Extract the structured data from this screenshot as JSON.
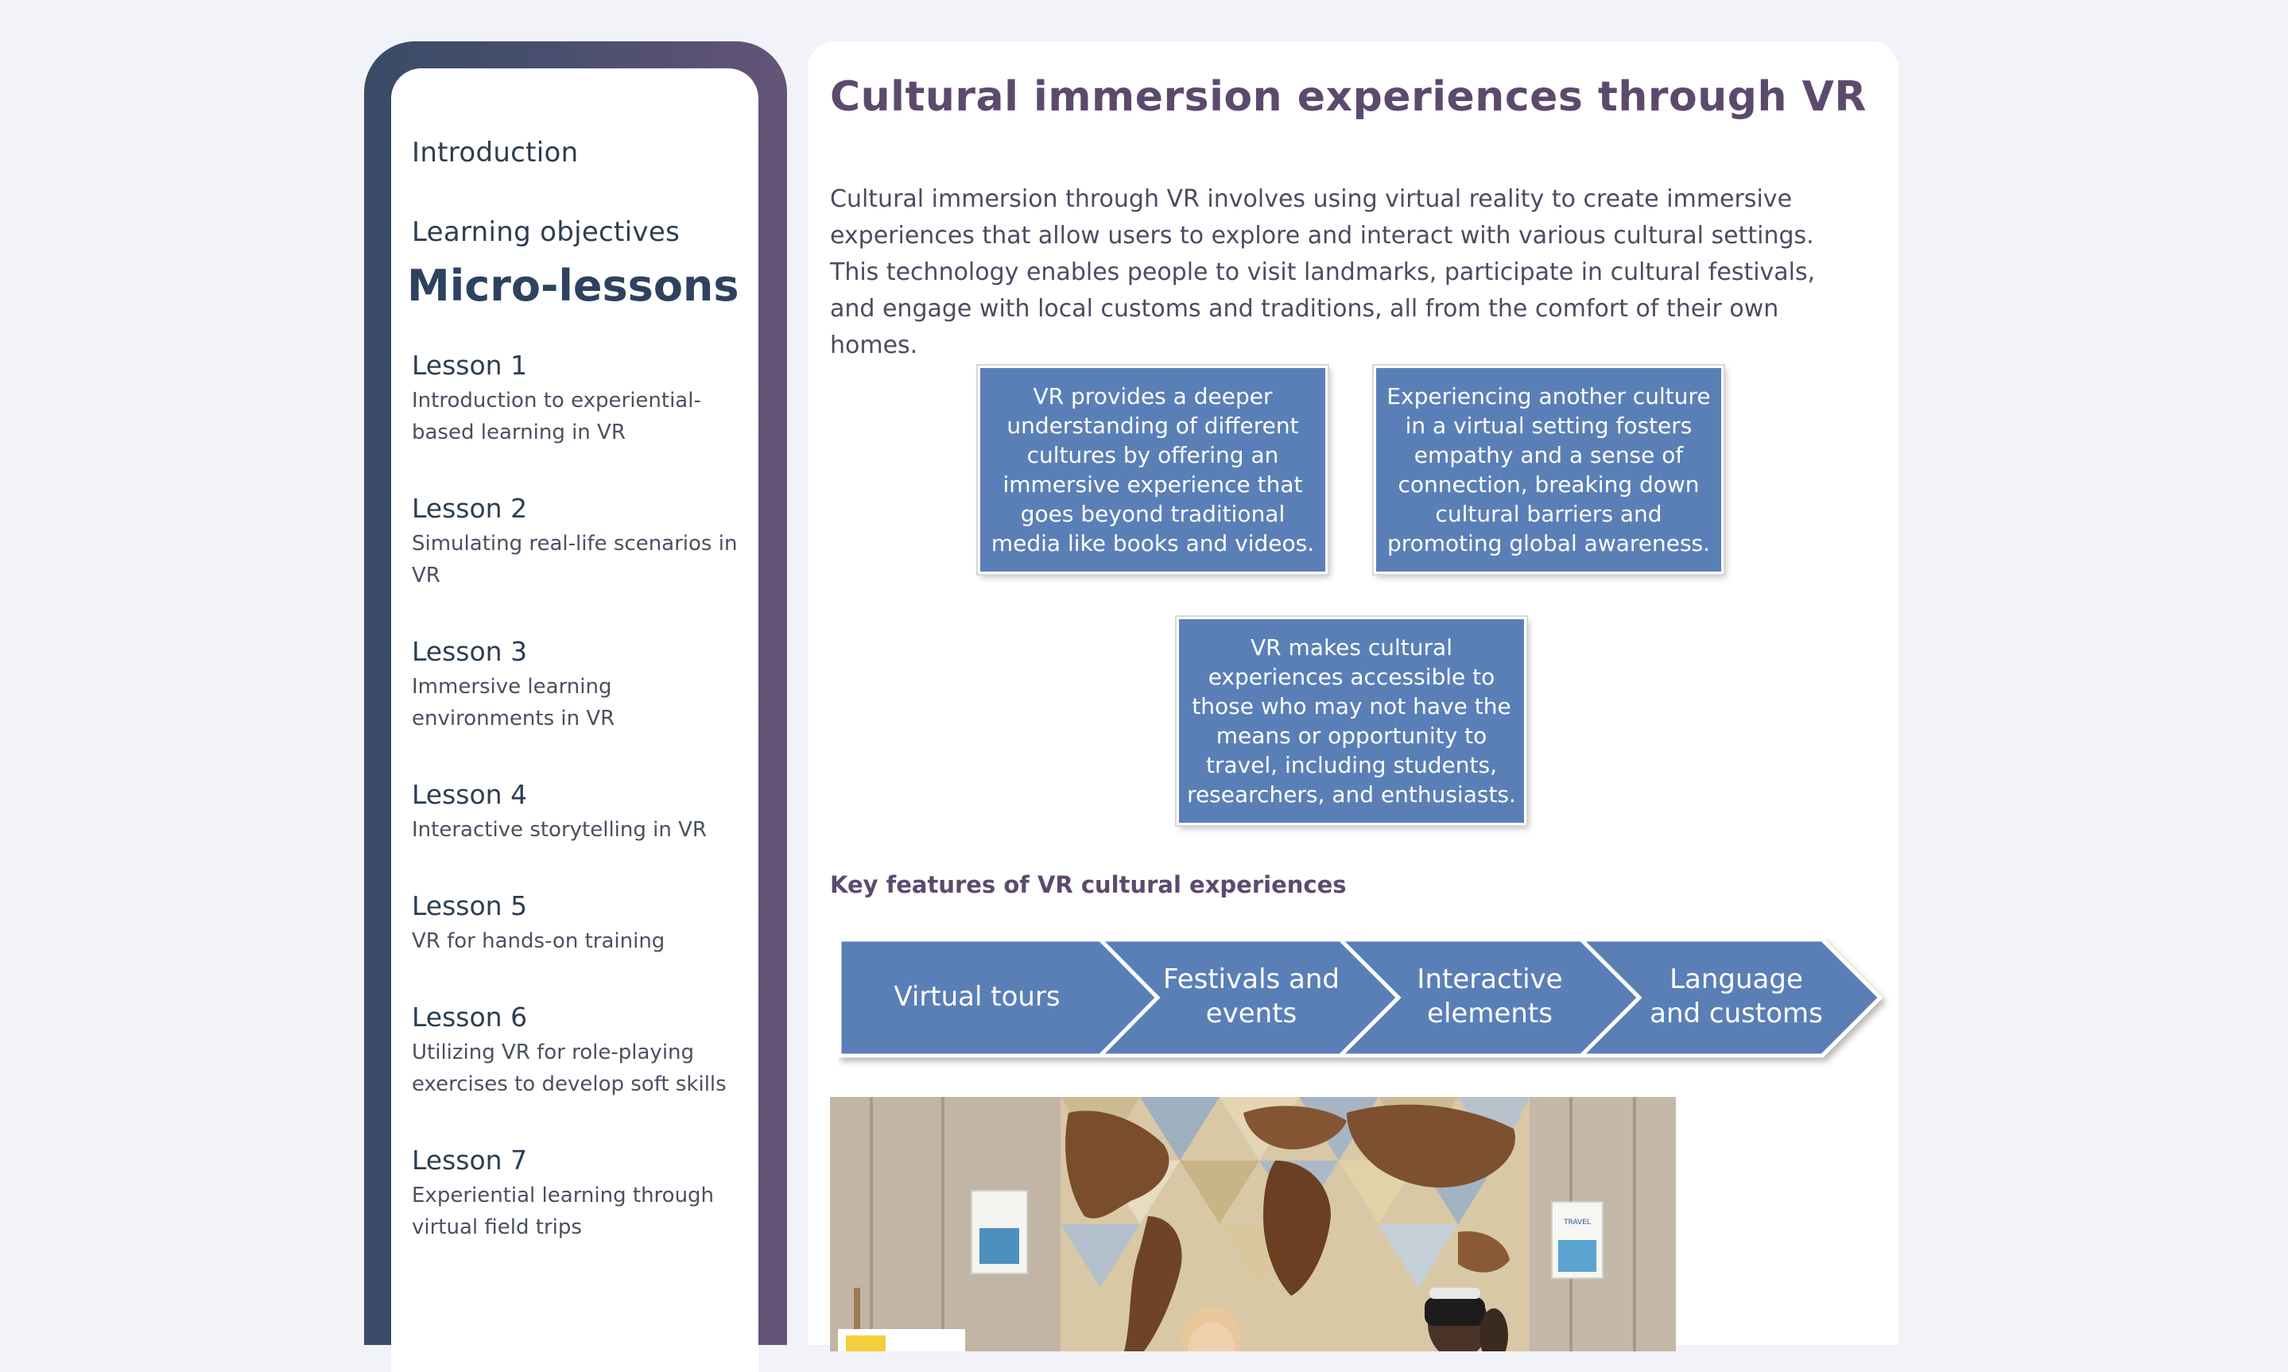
{
  "sidebar": {
    "nav": {
      "intro": "Introduction",
      "objectives": "Learning objectives"
    },
    "section_heading": "Micro-lessons",
    "lessons": [
      {
        "title": "Lesson 1",
        "desc": "Introduction to experiential-based learning in VR"
      },
      {
        "title": "Lesson 2",
        "desc": "Simulating real-life scenarios in VR"
      },
      {
        "title": "Lesson 3",
        "desc": "Immersive learning environments in VR"
      },
      {
        "title": "Lesson 4",
        "desc": "Interactive storytelling in VR"
      },
      {
        "title": "Lesson 5",
        "desc": "VR for hands-on training"
      },
      {
        "title": "Lesson 6",
        "desc": "Utilizing VR for role-playing exercises to develop soft skills"
      },
      {
        "title": "Lesson 7",
        "desc": "Experiential learning through virtual field trips"
      }
    ]
  },
  "main": {
    "title": "Cultural immersion experiences through VR",
    "intro": "Cultural immersion through VR involves using virtual reality to create immersive experiences that allow users to explore and interact with various cultural settings. This technology enables people to visit landmarks, participate in cultural festivals, and engage with local customs and traditions, all from the comfort of their own homes.",
    "concepts": [
      "VR provides a deeper understanding of different cultures by offering an immersive experience that goes beyond traditional media like books and videos.",
      "Experiencing another culture in a virtual setting fosters empathy and a sense of connection, breaking down cultural barriers and promoting global awareness.",
      "VR makes cultural experiences accessible to those who may not have the means or opportunity to travel, including students, researchers, and enthusiasts."
    ],
    "features_heading": "Key features of VR cultural experiences",
    "features": [
      "Virtual tours",
      "Festivals and events",
      "Interactive elements",
      "Language and customs"
    ],
    "photo_poster_text": "TRAVEL"
  },
  "colors": {
    "accent_blue": "#5a7fb7",
    "title_purple": "#5c4a6e",
    "nav_dark": "#2c3e50"
  }
}
